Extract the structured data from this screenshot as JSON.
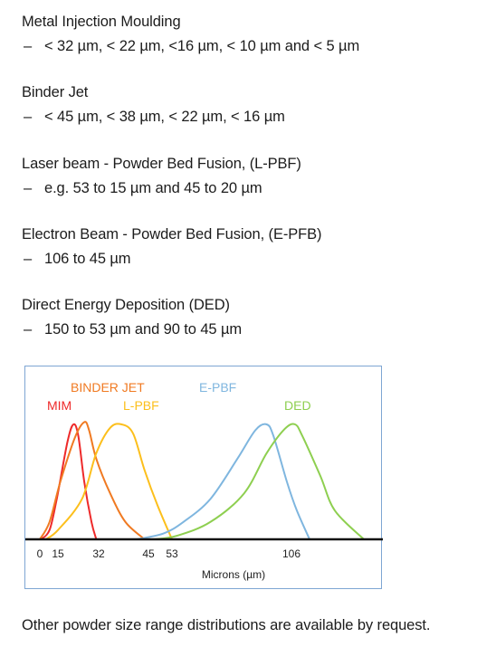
{
  "sections": [
    {
      "heading": "Metal Injection Moulding",
      "dash": "–",
      "detail": "< 32 µm, < 22 µm, <16 µm, < 10 µm and < 5 µm"
    },
    {
      "heading": "Binder Jet",
      "dash": "–",
      "detail": "< 45 µm, < 38 µm, < 22 µm, < 16 µm"
    },
    {
      "heading": "Laser beam - Powder Bed Fusion, (L-PBF)",
      "dash": "–",
      "detail": "e.g. 53 to 15 µm and 45 to 20 µm"
    },
    {
      "heading": "Electron Beam - Powder Bed Fusion, (E-PFB)",
      "dash": "–",
      "detail": "106 to 45 µm"
    },
    {
      "heading": "Direct Energy Deposition (DED)",
      "dash": "–",
      "detail": "150 to 53 µm and 90 to 45 µm"
    }
  ],
  "footer": "Other powder size range distributions are available by request.",
  "chart_data": {
    "type": "line",
    "title": "",
    "xlabel": "Microns (µm)",
    "ylabel": "",
    "x_ticks": [
      0,
      15,
      32,
      45,
      53,
      106
    ],
    "x_tick_labels": [
      "0",
      "15",
      "32",
      "45",
      "53",
      "106"
    ],
    "xlim": [
      0,
      150
    ],
    "ylim": [
      0,
      1
    ],
    "grid": false,
    "legend": "inline-labels-top",
    "series": [
      {
        "name": "MIM",
        "color": "#ee2a2a",
        "points": [
          [
            1,
            0
          ],
          [
            8,
            0.08
          ],
          [
            14,
            0.35
          ],
          [
            19,
            0.85
          ],
          [
            21.5,
            1.0
          ],
          [
            23.5,
            0.9
          ],
          [
            26,
            0.5
          ],
          [
            29,
            0.15
          ],
          [
            31,
            0
          ]
        ]
      },
      {
        "name": "BINDER JET",
        "color": "#f07a22",
        "points": [
          [
            0,
            0
          ],
          [
            8,
            0.15
          ],
          [
            16,
            0.5
          ],
          [
            22,
            0.88
          ],
          [
            26,
            1.02
          ],
          [
            28,
            0.95
          ],
          [
            31,
            0.7
          ],
          [
            35,
            0.4
          ],
          [
            39,
            0.15
          ],
          [
            44,
            0
          ]
        ]
      },
      {
        "name": "L-PBF",
        "color": "#fcbf1c",
        "points": [
          [
            5,
            0
          ],
          [
            15,
            0.08
          ],
          [
            25,
            0.35
          ],
          [
            31,
            0.75
          ],
          [
            35,
            0.97
          ],
          [
            38,
            1.0
          ],
          [
            41,
            0.92
          ],
          [
            44,
            0.6
          ],
          [
            48,
            0.3
          ],
          [
            53,
            0
          ]
        ]
      },
      {
        "name": "E-PBF",
        "color": "#7fb6df",
        "points": [
          [
            42,
            0
          ],
          [
            50,
            0.05
          ],
          [
            58,
            0.15
          ],
          [
            70,
            0.35
          ],
          [
            82,
            0.7
          ],
          [
            90,
            0.95
          ],
          [
            95,
            1.0
          ],
          [
            98,
            0.9
          ],
          [
            104,
            0.5
          ],
          [
            109,
            0.25
          ],
          [
            116,
            0
          ]
        ]
      },
      {
        "name": "DED",
        "color": "#8ecf50",
        "points": [
          [
            47,
            0
          ],
          [
            55,
            0.03
          ],
          [
            70,
            0.15
          ],
          [
            85,
            0.4
          ],
          [
            95,
            0.75
          ],
          [
            103,
            0.96
          ],
          [
            108,
            1.0
          ],
          [
            112,
            0.9
          ],
          [
            122,
            0.55
          ],
          [
            130,
            0.25
          ],
          [
            146,
            0
          ]
        ]
      }
    ]
  }
}
